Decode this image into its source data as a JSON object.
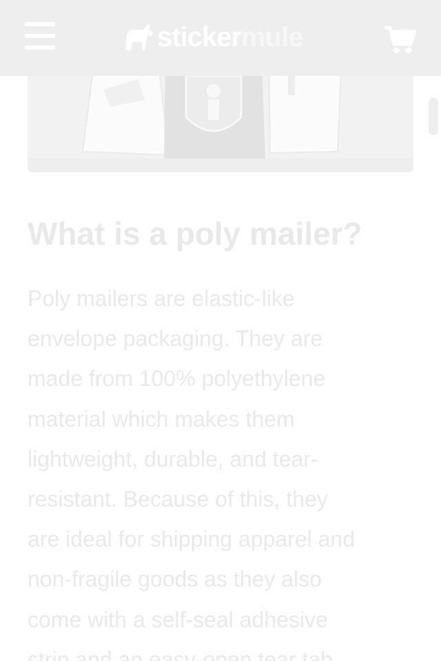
{
  "header": {
    "menu_icon": "hamburger-icon",
    "logo_part1": "sticker",
    "logo_part2": "mule",
    "logo_icon": "mule-icon",
    "cart_icon": "shopping-cart-icon",
    "background": "#eeeeee"
  },
  "hero": {
    "image": "poly mailer bags photo"
  },
  "article": {
    "heading": "What is a poly mailer?",
    "lines": [
      "Poly mailers are elastic-like",
      "envelope packaging. They are",
      "made from 100% polyethylene",
      "material which makes them",
      "lightweight, durable, and tear-",
      "resistant. Because of this, they",
      "are ideal for shipping apparel and",
      "non-fragile goods as they also",
      "come with a self-seal adhesive",
      "strip and an easy-open tear tab."
    ]
  },
  "colors": {
    "header_bg": "#eeeeee",
    "text": "#e9e9e9"
  }
}
